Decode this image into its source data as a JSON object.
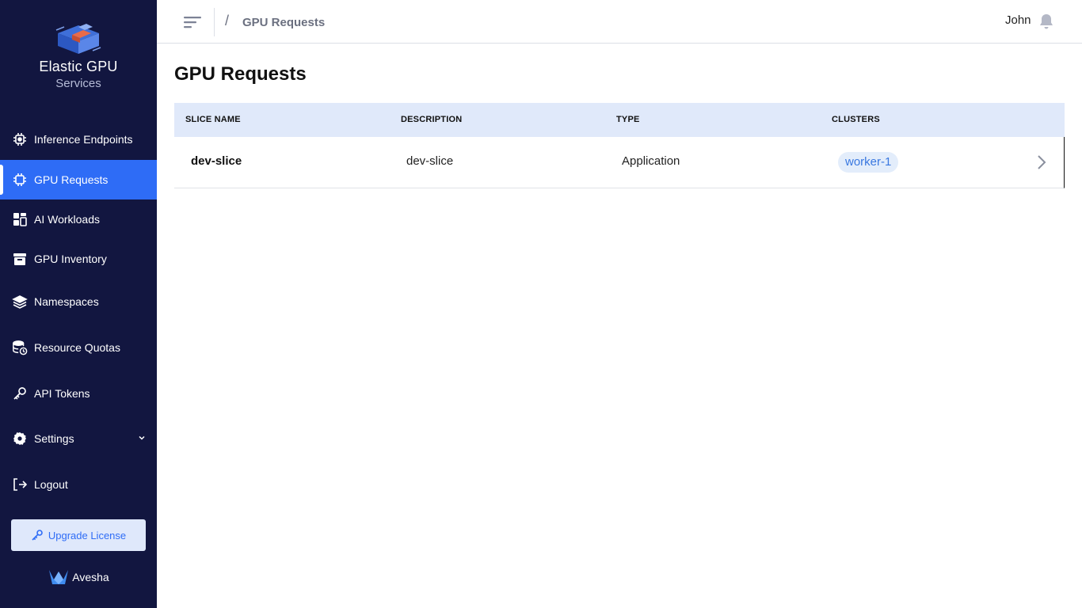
{
  "brand": {
    "title": "Elastic GPU",
    "subtitle": "Services"
  },
  "sidebar": {
    "items": [
      {
        "label": "Inference Endpoints",
        "icon": "chip-icon"
      },
      {
        "label": "GPU Requests",
        "icon": "chip-icon",
        "active": true
      },
      {
        "label": "AI Workloads",
        "icon": "dashboard-icon"
      },
      {
        "label": "GPU Inventory",
        "icon": "archive-icon"
      },
      {
        "label": "Namespaces",
        "icon": "layers-icon"
      },
      {
        "label": "Resource Quotas",
        "icon": "database-clock-icon"
      },
      {
        "label": "API Tokens",
        "icon": "key-icon"
      },
      {
        "label": "Settings",
        "icon": "gear-icon"
      },
      {
        "label": "Logout",
        "icon": "logout-icon"
      }
    ],
    "upgrade_label": "Upgrade License",
    "footer_brand": "Avesha"
  },
  "header": {
    "breadcrumb_separator": "/",
    "breadcrumb": "GPU Requests",
    "user_name": "John"
  },
  "main": {
    "title": "GPU Requests",
    "table": {
      "columns": [
        "SLICE NAME",
        "DESCRIPTION",
        "TYPE",
        "CLUSTERS"
      ],
      "rows": [
        {
          "slice_name": "dev-slice",
          "description": "dev-slice",
          "type": "Application",
          "clusters": [
            "worker-1"
          ]
        }
      ]
    }
  },
  "colors": {
    "sidebar_bg": "#121640",
    "accent": "#2e6cf6",
    "table_header_bg": "#e0e9fa",
    "pill_bg": "#e3edfb"
  }
}
